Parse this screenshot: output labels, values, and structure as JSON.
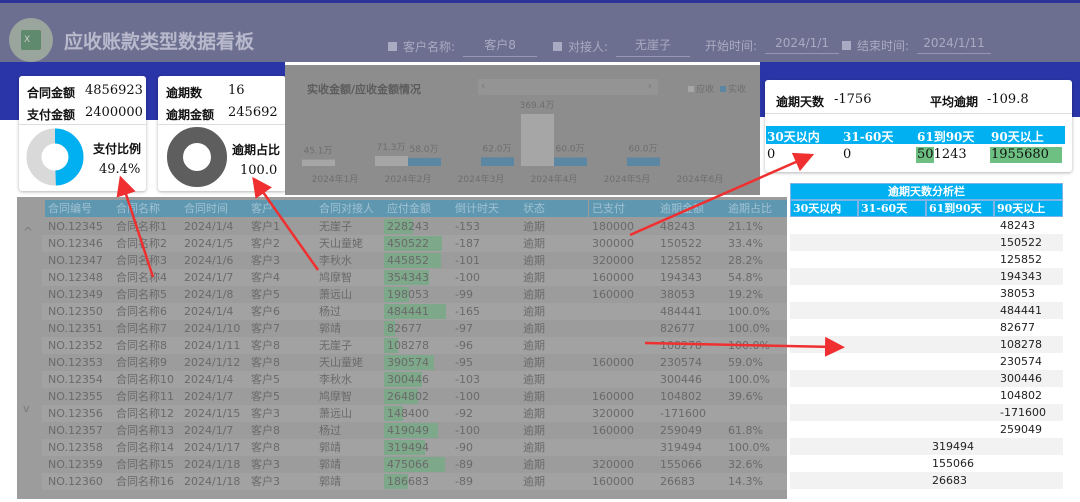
{
  "header": {
    "title": "应收账款类型数据看板",
    "logo_text": "X",
    "filters": [
      {
        "label": "客户名称:",
        "value": "客户8",
        "checkbox": true
      },
      {
        "label": "对接人:",
        "value": "无崖子",
        "checkbox": true
      },
      {
        "label": "开始时间:",
        "value": "2024/1/1",
        "checkbox": false
      },
      {
        "label": "结束时间:",
        "value": "2024/1/11",
        "checkbox": true
      }
    ]
  },
  "card1": {
    "contract_label": "合同金额",
    "contract_value": "4856923",
    "paid_label": "支付金额",
    "paid_value": "2400000",
    "ratio_label": "支付比例",
    "ratio_value": "49.4%",
    "ratio": 0.494
  },
  "card2": {
    "count_label": "逾期数",
    "count_value": "16",
    "amount_label": "逾期金额",
    "amount_value": "245692",
    "ratio_label": "逾期占比",
    "ratio_value": "100.0",
    "ratio": 1.0
  },
  "chart_data": {
    "type": "bar",
    "title": "实收金额/应收金额情况",
    "categories": [
      "2024年1月",
      "2024年2月",
      "2024年3月",
      "2024年4月",
      "2024年5月",
      "2024年6月"
    ],
    "series": [
      {
        "name": "应收",
        "color": "#a6a6a6",
        "values": [
          45.1,
          71.3,
          null,
          369.4,
          null,
          null
        ],
        "labels": [
          "45.1万",
          "71.3万",
          "",
          "369.4万",
          "",
          ""
        ]
      },
      {
        "name": "实收",
        "color": "#5b87a3",
        "values": [
          null,
          58.0,
          62.0,
          60.0,
          60.0,
          null
        ],
        "labels": [
          "",
          "58.0万",
          "62.0万",
          "60.0万",
          "60.0万",
          ""
        ]
      }
    ],
    "unit": "万",
    "legend": "top-right",
    "scroll_prev": "‹",
    "scroll_next": "›"
  },
  "table": {
    "columns": [
      "合同编号",
      "合同名称",
      "合同时间",
      "客户",
      "合同对接人",
      "应付金额",
      "倒计时天",
      "状态",
      "已支付",
      "逾期金额",
      "逾期占比"
    ],
    "scroll_up": "^",
    "scroll_down": "v",
    "rows": [
      [
        "NO.12345",
        "合同名称1",
        "2024/1/4",
        "客户1",
        "无崖子",
        "228243",
        "-153",
        "逾期",
        "180000",
        "48243",
        "21.1%"
      ],
      [
        "NO.12346",
        "合同名称2",
        "2024/1/5",
        "客户2",
        "天山童姥",
        "450522",
        "-187",
        "逾期",
        "300000",
        "150522",
        "33.4%"
      ],
      [
        "NO.12347",
        "合同名称3",
        "2024/1/6",
        "客户3",
        "李秋水",
        "445852",
        "-101",
        "逾期",
        "320000",
        "125852",
        "28.2%"
      ],
      [
        "NO.12348",
        "合同名称4",
        "2024/1/7",
        "客户4",
        "鸠摩智",
        "354343",
        "-100",
        "逾期",
        "160000",
        "194343",
        "54.8%"
      ],
      [
        "NO.12349",
        "合同名称5",
        "2024/1/8",
        "客户5",
        "萧远山",
        "198053",
        "-99",
        "逾期",
        "160000",
        "38053",
        "19.2%"
      ],
      [
        "NO.12350",
        "合同名称6",
        "2024/1/4",
        "客户6",
        "杨过",
        "484441",
        "-165",
        "逾期",
        "",
        "484441",
        "100.0%"
      ],
      [
        "NO.12351",
        "合同名称7",
        "2024/1/10",
        "客户7",
        "郭靖",
        "82677",
        "-97",
        "逾期",
        "",
        "82677",
        "100.0%"
      ],
      [
        "NO.12352",
        "合同名称8",
        "2024/1/11",
        "客户8",
        "无崖子",
        "108278",
        "-96",
        "逾期",
        "",
        "108278",
        "100.0%"
      ],
      [
        "NO.12353",
        "合同名称9",
        "2024/1/12",
        "客户8",
        "天山童姥",
        "390574",
        "-95",
        "逾期",
        "160000",
        "230574",
        "59.0%"
      ],
      [
        "NO.12354",
        "合同名称10",
        "2024/1/4",
        "客户5",
        "李秋水",
        "300446",
        "-103",
        "逾期",
        "",
        "300446",
        "100.0%"
      ],
      [
        "NO.12355",
        "合同名称11",
        "2024/1/7",
        "客户5",
        "鸠摩智",
        "264802",
        "-100",
        "逾期",
        "160000",
        "104802",
        "39.6%"
      ],
      [
        "NO.12356",
        "合同名称12",
        "2024/1/15",
        "客户3",
        "萧远山",
        "148400",
        "-92",
        "逾期",
        "320000",
        "-171600",
        ""
      ],
      [
        "NO.12357",
        "合同名称13",
        "2024/1/7",
        "客户8",
        "杨过",
        "419049",
        "-100",
        "逾期",
        "160000",
        "259049",
        "61.8%"
      ],
      [
        "NO.12358",
        "合同名称14",
        "2024/1/17",
        "客户8",
        "郭靖",
        "319494",
        "-90",
        "逾期",
        "",
        "319494",
        "100.0%"
      ],
      [
        "NO.12359",
        "合同名称15",
        "2024/1/18",
        "客户3",
        "郭靖",
        "475066",
        "-89",
        "逾期",
        "320000",
        "155066",
        "32.6%"
      ],
      [
        "NO.12360",
        "合同名称16",
        "2024/1/18",
        "客户3",
        "郭靖",
        "186683",
        "-89",
        "逾期",
        "160000",
        "26683",
        "14.3%"
      ]
    ]
  },
  "overdue": {
    "days_label": "逾期天数",
    "days_value": "-1756",
    "avg_label": "平均逾期",
    "avg_value": "-109.8",
    "buckets": [
      "30天以内",
      "31-60天",
      "61到90天",
      "90天以上"
    ],
    "values": [
      "0",
      "0",
      "501243",
      "1955680"
    ]
  },
  "analysis": {
    "title": "逾期天数分析栏",
    "columns": [
      "30天以内",
      "31-60天",
      "61到90天",
      "90天以上"
    ],
    "rows": [
      [
        "",
        "",
        "",
        "48243"
      ],
      [
        "",
        "",
        "",
        "150522"
      ],
      [
        "",
        "",
        "",
        "125852"
      ],
      [
        "",
        "",
        "",
        "194343"
      ],
      [
        "",
        "",
        "",
        "38053"
      ],
      [
        "",
        "",
        "",
        "484441"
      ],
      [
        "",
        "",
        "",
        "82677"
      ],
      [
        "",
        "",
        "",
        "108278"
      ],
      [
        "",
        "",
        "",
        "230574"
      ],
      [
        "",
        "",
        "",
        "300446"
      ],
      [
        "",
        "",
        "",
        "104802"
      ],
      [
        "",
        "",
        "",
        "-171600"
      ],
      [
        "",
        "",
        "",
        "259049"
      ],
      [
        "",
        "",
        "319494",
        ""
      ],
      [
        "",
        "",
        "155066",
        ""
      ],
      [
        "",
        "",
        "26683",
        ""
      ]
    ]
  },
  "colors": {
    "header": "#6c6f8f",
    "band": "#2a35a8",
    "accent": "#00b0f0",
    "green": "#6dbf82",
    "annotation": "#f03030"
  }
}
